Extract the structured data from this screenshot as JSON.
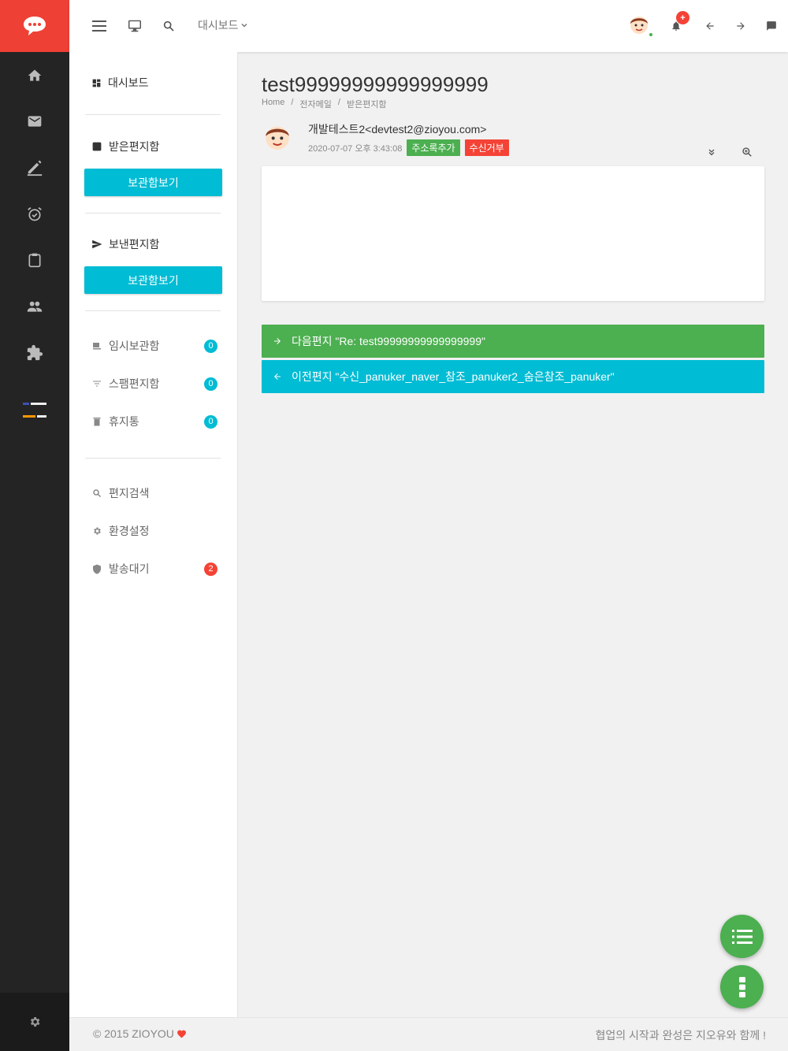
{
  "topbar": {
    "dashboard_label": "대시보드",
    "notification_badge": "+"
  },
  "sidemenu": {
    "dashboard": "대시보드",
    "inbox": "받은편지함",
    "inbox_button": "보관함보기",
    "sent": "보낸편지함",
    "sent_button": "보관함보기",
    "items": [
      {
        "label": "임시보관함",
        "count": "0"
      },
      {
        "label": "스팸편지함",
        "count": "0"
      },
      {
        "label": "휴지통",
        "count": "0"
      }
    ],
    "search": "편지검색",
    "settings": "환경설정",
    "outbox": {
      "label": "발송대기",
      "count": "2"
    }
  },
  "main": {
    "title": "test99999999999999999",
    "breadcrumb": [
      "Home",
      "/",
      "전자메일",
      "/",
      "받은편지함"
    ],
    "sender": "개발테스트2<devtest2@zioyou.com>",
    "date": "2020-07-07 오후 3:43:08",
    "tag_add": "주소록추가",
    "tag_block": "수신거부",
    "next_mail": "다음편지 \"Re: test99999999999999999\"",
    "prev_mail": "이전편지 \"수신_panuker_naver_참조_panuker2_숨은참조_panuker\""
  },
  "footer": {
    "copyright": "© 2015 ZIOYOU",
    "slogan": "협업의 시작과 완성은 지오유와 함께 !"
  },
  "colors": {
    "accent_red": "#ef4036",
    "cyan": "#00bcd4",
    "green": "#4caf50",
    "rail": "#242424"
  }
}
